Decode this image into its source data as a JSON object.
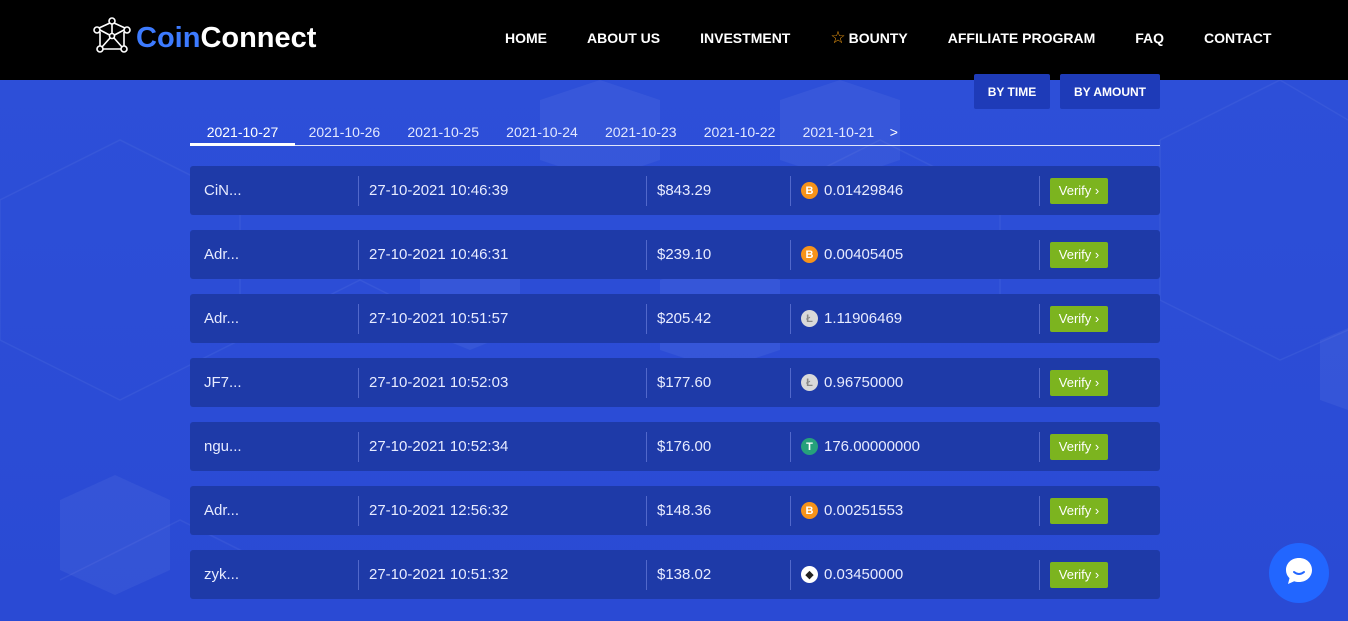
{
  "brand": {
    "coin": "Coin",
    "connect": "Connect",
    "logo_icon": "network-globe-icon"
  },
  "nav": [
    {
      "label": "HOME"
    },
    {
      "label": "ABOUT US"
    },
    {
      "label": "INVESTMENT"
    },
    {
      "label": "BOUNTY",
      "icon": "star-icon"
    },
    {
      "label": "AFFILIATE PROGRAM"
    },
    {
      "label": "FAQ"
    },
    {
      "label": "CONTACT"
    }
  ],
  "sort": {
    "by_time": "BY TIME",
    "by_amount": "BY AMOUNT"
  },
  "tabs": [
    "2021-10-27",
    "2021-10-26",
    "2021-10-25",
    "2021-10-24",
    "2021-10-23",
    "2021-10-22",
    "2021-10-21"
  ],
  "tab_next": ">",
  "rows": [
    {
      "user": "CiN...",
      "time": "27-10-2021 10:46:39",
      "amount": "$843.29",
      "coin": "btc",
      "crypto": "0.01429846",
      "verify": "Verify ›"
    },
    {
      "user": "Adr...",
      "time": "27-10-2021 10:46:31",
      "amount": "$239.10",
      "coin": "btc",
      "crypto": "0.00405405",
      "verify": "Verify ›"
    },
    {
      "user": "Adr...",
      "time": "27-10-2021 10:51:57",
      "amount": "$205.42",
      "coin": "ltc",
      "crypto": "1.11906469",
      "verify": "Verify ›"
    },
    {
      "user": "JF7...",
      "time": "27-10-2021 10:52:03",
      "amount": "$177.60",
      "coin": "ltc",
      "crypto": "0.96750000",
      "verify": "Verify ›"
    },
    {
      "user": "ngu...",
      "time": "27-10-2021 10:52:34",
      "amount": "$176.00",
      "coin": "usdt",
      "crypto": "176.00000000",
      "verify": "Verify ›"
    },
    {
      "user": "Adr...",
      "time": "27-10-2021 12:56:32",
      "amount": "$148.36",
      "coin": "btc",
      "crypto": "0.00251553",
      "verify": "Verify ›"
    },
    {
      "user": "zyk...",
      "time": "27-10-2021 10:51:32",
      "amount": "$138.02",
      "coin": "eth",
      "crypto": "0.03450000",
      "verify": "Verify ›"
    }
  ],
  "coin_glyphs": {
    "btc": "B",
    "ltc": "Ł",
    "usdt": "T",
    "eth": "◆"
  },
  "colors": {
    "accent": "#3d7bff",
    "verify": "#7cb41f",
    "btc": "#f7931a",
    "usdt": "#26a17b"
  },
  "chat": {
    "icon": "chat-bubble-icon"
  }
}
